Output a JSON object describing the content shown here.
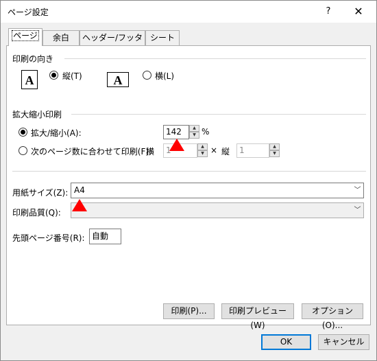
{
  "window": {
    "title": "ページ設定",
    "help_label": "?",
    "close_label": "✕"
  },
  "tabs": [
    {
      "label": "ページ",
      "active": true
    },
    {
      "label": "余白",
      "active": false
    },
    {
      "label": "ヘッダー/フッター",
      "active": false
    },
    {
      "label": "シート",
      "active": false
    }
  ],
  "orientation": {
    "group_label": "印刷の向き",
    "portrait_icon_letter": "A",
    "portrait_label": "縦(T)",
    "landscape_icon_letter": "A",
    "landscape_label": "横(L)",
    "selected": "portrait"
  },
  "scaling": {
    "group_label": "拡大縮小印刷",
    "adjust_label": "拡大/縮小(A):",
    "adjust_value": "142",
    "percent_unit": "%",
    "fit_label": "次のページ数に合わせて印刷(F):",
    "wide_label": "横",
    "wide_value": "1",
    "times_sign": "×",
    "tall_label": "縦",
    "tall_value": "1",
    "selected": "adjust"
  },
  "paper": {
    "size_label": "用紙サイズ(Z):",
    "size_value": "A4",
    "quality_label": "印刷品質(Q):",
    "quality_value": ""
  },
  "first_page": {
    "label": "先頭ページ番号(R):",
    "value": "自動"
  },
  "actions": {
    "print_label": "印刷(P)...",
    "preview_label": "印刷プレビュー(W)",
    "options_label": "オプション(O)..."
  },
  "footer": {
    "ok_label": "OK",
    "cancel_label": "キャンセル"
  },
  "colors": {
    "marker": "#ff0000",
    "default_button_border": "#0078d7"
  },
  "icons": {
    "spin_up": "▲",
    "spin_down": "▼",
    "dropdown": "﹀"
  }
}
